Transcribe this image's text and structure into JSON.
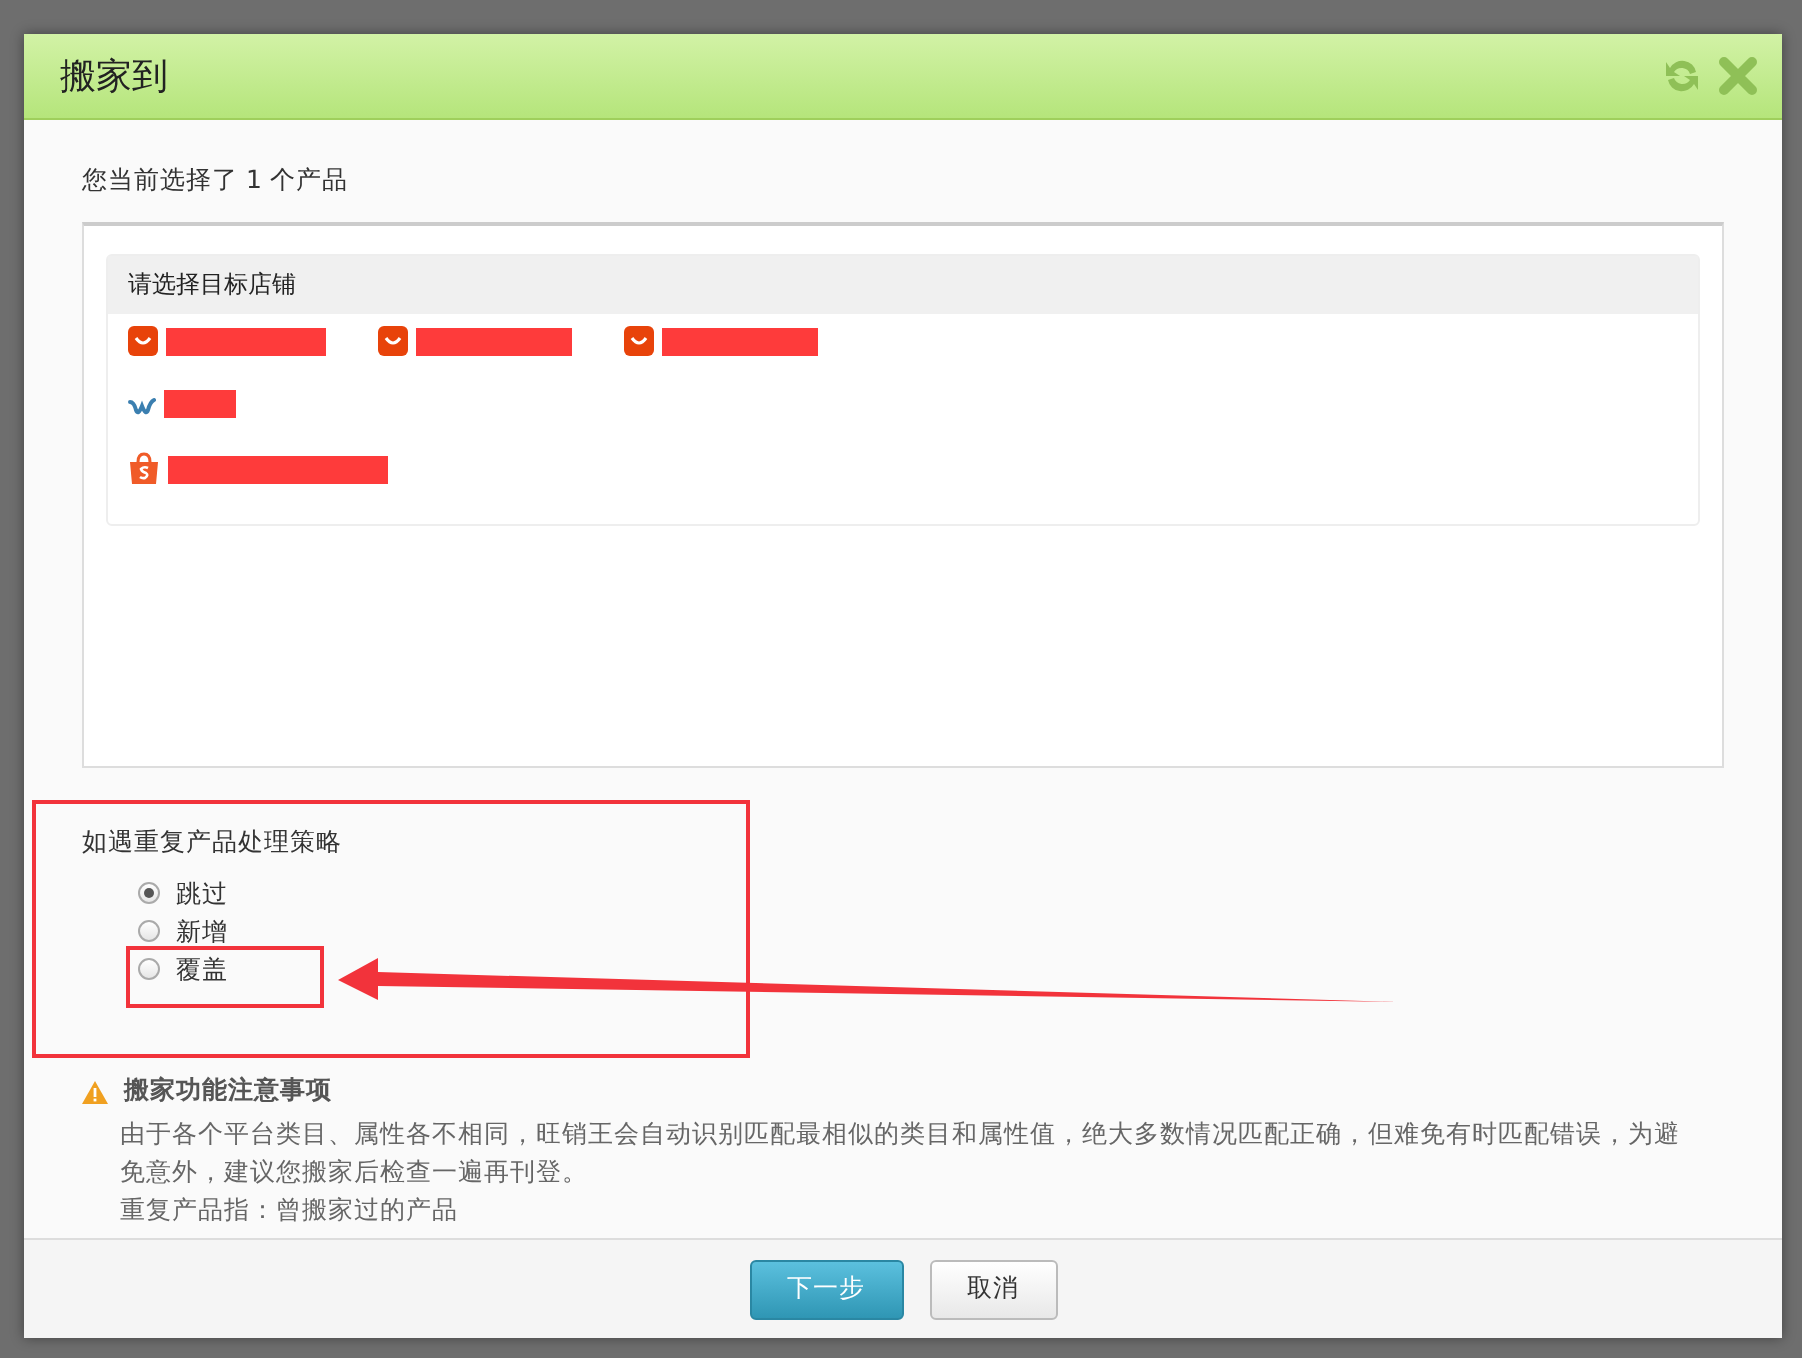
{
  "dialog": {
    "title": "搬家到",
    "selection_summary": "您当前选择了 1 个产品"
  },
  "store_picker": {
    "heading": "请选择目标店铺",
    "rows": [
      {
        "stores": [
          {
            "kind": "aliexpress"
          },
          {
            "kind": "aliexpress"
          },
          {
            "kind": "aliexpress"
          }
        ]
      },
      {
        "stores": [
          {
            "kind": "wish"
          }
        ]
      },
      {
        "stores": [
          {
            "kind": "shopee"
          }
        ]
      }
    ]
  },
  "duplicate_strategy": {
    "label": "如遇重复产品处理策略",
    "options": [
      {
        "label": "跳过",
        "selected": true
      },
      {
        "label": "新增",
        "selected": false
      },
      {
        "label": "覆盖",
        "selected": false
      }
    ]
  },
  "notice": {
    "title": "搬家功能注意事项",
    "lines": [
      "由于各个平台类目、属性各不相同，旺销王会自动识别匹配最相似的类目和属性值，绝大多数情况匹配正确，但难免有时匹配错误，为避免意外，建议您搬家后检查一遍再刊登。",
      "重复产品指：曾搬家过的产品"
    ]
  },
  "buttons": [
    {
      "label": "下一步",
      "kind": "primary"
    },
    {
      "label": "取消",
      "kind": "default"
    }
  ]
}
